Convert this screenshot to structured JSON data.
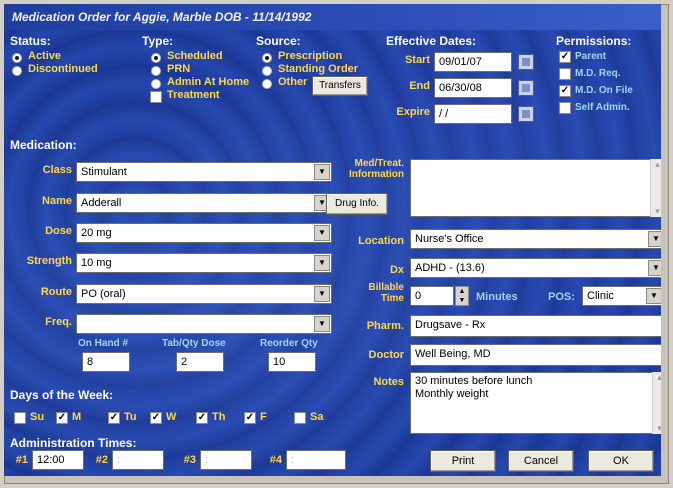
{
  "window": {
    "title": "Medication Order for Aggie, Marble DOB - 11/14/1992"
  },
  "status": {
    "label": "Status:",
    "options": [
      {
        "label": "Active",
        "selected": true
      },
      {
        "label": "Discontinued",
        "selected": false
      }
    ]
  },
  "type": {
    "label": "Type:",
    "options": [
      {
        "label": "Scheduled",
        "selected": true
      },
      {
        "label": "PRN",
        "selected": false
      },
      {
        "label": "Admin At Home",
        "selected": false
      }
    ],
    "treatment_label": "Treatment",
    "treatment_checked": false
  },
  "source": {
    "label": "Source:",
    "options": [
      {
        "label": "Prescription",
        "selected": true
      },
      {
        "label": "Standing Order",
        "selected": false
      },
      {
        "label": "Other",
        "selected": false
      }
    ],
    "transfers_label": "Transfers"
  },
  "dates": {
    "label": "Effective Dates:",
    "start_label": "Start",
    "start_value": "09/01/07",
    "end_label": "End",
    "end_value": "06/30/08",
    "expire_label": "Expire",
    "expire_value": "/ /"
  },
  "permissions": {
    "label": "Permissions:",
    "items": [
      {
        "label": "Parent",
        "checked": true
      },
      {
        "label": "M.D. Req.",
        "checked": false
      },
      {
        "label": "M.D. On File",
        "checked": true
      },
      {
        "label": "Self Admin.",
        "checked": false
      }
    ]
  },
  "medication": {
    "label": "Medication:",
    "class_label": "Class",
    "class_value": "Stimulant",
    "name_label": "Name",
    "name_value": "Adderall",
    "drug_info_label": "Drug Info.",
    "dose_label": "Dose",
    "dose_value": "20 mg",
    "strength_label": "Strength",
    "strength_value": "10 mg",
    "route_label": "Route",
    "route_value": "PO (oral)",
    "freq_label": "Freq.",
    "freq_value": "",
    "onhand_label": "On Hand #",
    "onhand_value": "8",
    "tabqty_label": "Tab/Qty Dose",
    "tabqty_value": "2",
    "reorder_label": "Reorder Qty",
    "reorder_value": "10"
  },
  "right": {
    "medtreat_label_1": "Med/Treat.",
    "medtreat_label_2": "Information",
    "medtreat_value": "",
    "location_label": "Location",
    "location_value": "Nurse's Office",
    "dx_label": "Dx",
    "dx_value": "ADHD - (13.6)",
    "billable_label_1": "Billable",
    "billable_label_2": "Time",
    "billable_value": "0",
    "minutes_label": "Minutes",
    "pos_label": "POS:",
    "pos_value": "Clinic",
    "pharm_label": "Pharm.",
    "pharm_value": "Drugsave - Rx",
    "doctor_label": "Doctor",
    "doctor_value": "Well Being, MD",
    "notes_label": "Notes",
    "notes_line1": "30 minutes before lunch",
    "notes_line2": "Monthly weight"
  },
  "days": {
    "label": "Days of the Week:",
    "items": [
      {
        "label": "Su",
        "checked": false
      },
      {
        "label": "M",
        "checked": true
      },
      {
        "label": "Tu",
        "checked": true
      },
      {
        "label": "W",
        "checked": true
      },
      {
        "label": "Th",
        "checked": true
      },
      {
        "label": "F",
        "checked": true
      },
      {
        "label": "Sa",
        "checked": false
      }
    ]
  },
  "admin_times": {
    "label": "Administration Times:",
    "slots": [
      {
        "label": "#1",
        "value": "12:00"
      },
      {
        "label": "#2",
        "value": ":"
      },
      {
        "label": "#3",
        "value": ":"
      },
      {
        "label": "#4",
        "value": ":"
      }
    ]
  },
  "buttons": {
    "print": "Print",
    "cancel": "Cancel",
    "ok": "OK"
  },
  "colors": {
    "titlebar": "#2c4fb8",
    "background": "#2142a6",
    "field_label": "#ffd84a",
    "sub_label": "#9fd6ff",
    "header_text": "#ffffff"
  }
}
